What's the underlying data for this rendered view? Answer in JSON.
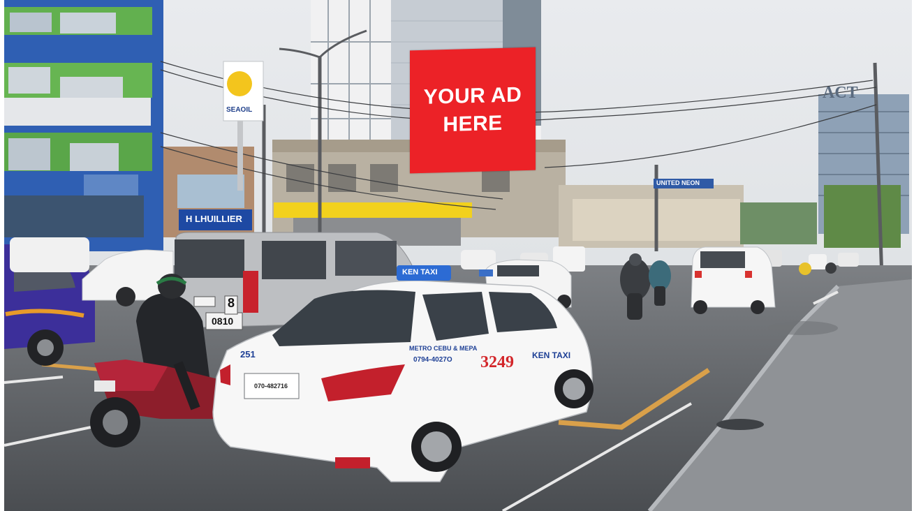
{
  "scene": {
    "billboard": {
      "line1": "YOUR AD",
      "line2": "HERE",
      "color": "#ec2227"
    },
    "signs": {
      "seaoil": "SEAOIL",
      "lhuillier": "H LHUILLIER",
      "united_neon": "UNITED NEON",
      "building": "ACT"
    },
    "taxi": {
      "number": "3249",
      "company": "KEN TAXI",
      "side_text": "METRO CEBU & MEPA",
      "phone": "0794-4027O",
      "roof_sign": "KEN TAXI",
      "rear_number": "251",
      "plate": "070-482716"
    },
    "van_plate": "8",
    "van_plate_bottom": "0810"
  }
}
